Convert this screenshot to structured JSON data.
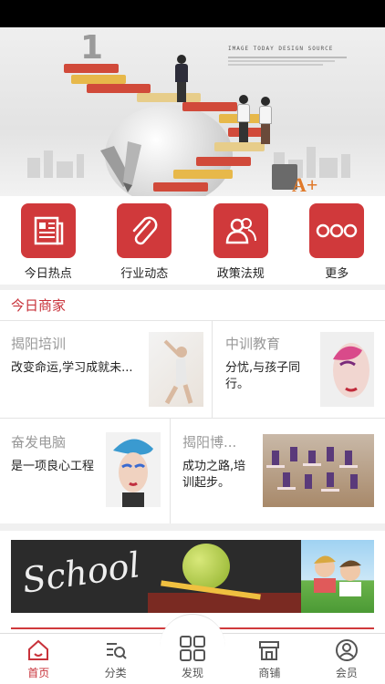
{
  "banner": {
    "tagline": "IMAGE TODAY DESIGN SOURCE",
    "big_number": "1"
  },
  "quick_links": [
    {
      "label": "今日热点",
      "icon": "newspaper-icon"
    },
    {
      "label": "行业动态",
      "icon": "paperclip-icon"
    },
    {
      "label": "政策法规",
      "icon": "users-icon"
    },
    {
      "label": "更多",
      "icon": "more-dots-icon"
    }
  ],
  "merchants": {
    "title": "今日商家",
    "items": [
      {
        "name": "揭阳培训",
        "desc": "改变命运,学习成就未..."
      },
      {
        "name": "中训教育",
        "desc": "分忧,与孩子同行。"
      },
      {
        "name": "奋发电脑",
        "desc": "是一项良心工程"
      },
      {
        "name": "揭阳博...",
        "desc": "成功之路,培训起步。"
      }
    ]
  },
  "ad": {
    "school_text": "School"
  },
  "tabbar": [
    {
      "label": "首页",
      "icon": "home-icon",
      "active": true
    },
    {
      "label": "分类",
      "icon": "category-search-icon",
      "active": false
    },
    {
      "label": "发现",
      "icon": "grid-icon",
      "active": false
    },
    {
      "label": "商铺",
      "icon": "shop-icon",
      "active": false
    },
    {
      "label": "会员",
      "icon": "user-icon",
      "active": false
    }
  ],
  "colors": {
    "accent": "#c8323a",
    "icon_bg": "#d0393b",
    "page_bg": "#f0f0f0"
  }
}
